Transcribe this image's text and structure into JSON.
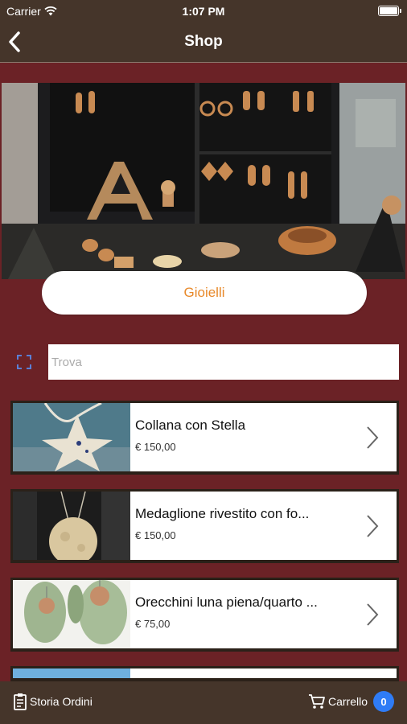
{
  "status_bar": {
    "carrier": "Carrier",
    "time": "1:07 PM"
  },
  "nav": {
    "title": "Shop",
    "back_icon": "chevron-left-icon"
  },
  "category": {
    "label": "Gioielli"
  },
  "search": {
    "placeholder": "Trova",
    "scan_icon": "scan-icon"
  },
  "products": [
    {
      "name": "Collana con Stella",
      "price": "€ 150,00"
    },
    {
      "name": "Medaglione rivestito con fo...",
      "price": "€ 150,00"
    },
    {
      "name": "Orecchini luna piena/quarto ...",
      "price": "€ 75,00"
    }
  ],
  "footer": {
    "orders_label": "Storia Ordini",
    "cart_label": "Carrello",
    "cart_count": "0"
  },
  "colors": {
    "bar": "#45352a",
    "background": "#6b2226",
    "accent": "#e8892a",
    "badge": "#2f7cf6"
  }
}
